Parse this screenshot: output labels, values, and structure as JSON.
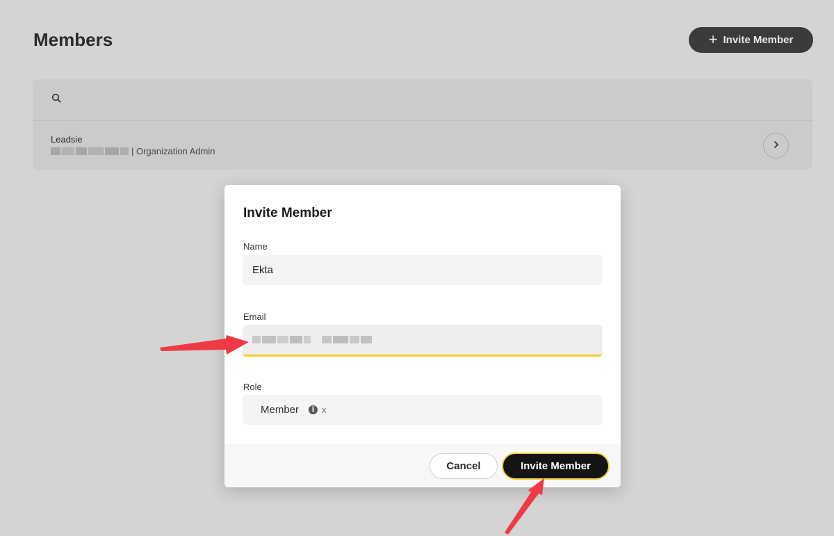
{
  "header": {
    "title": "Members",
    "invite_button_label": "Invite Member"
  },
  "members": [
    {
      "name": "Leadsie",
      "role_text": "| Organization Admin"
    }
  ],
  "modal": {
    "title": "Invite Member",
    "name_label": "Name",
    "name_value": "Ekta",
    "email_label": "Email",
    "role_label": "Role",
    "role_value": "Member",
    "role_info_glyph": "i",
    "role_remove_glyph": "x",
    "cancel_label": "Cancel",
    "submit_label": "Invite Member"
  },
  "colors": {
    "accent_yellow": "#f2cf2b",
    "annotation_arrow": "#ee3a44",
    "dark_button": "#141414"
  },
  "icons": {
    "search": "search-icon",
    "plus": "plus-icon",
    "chevron": "chevron-right-icon",
    "info": "info-icon",
    "remove": "close-icon"
  }
}
